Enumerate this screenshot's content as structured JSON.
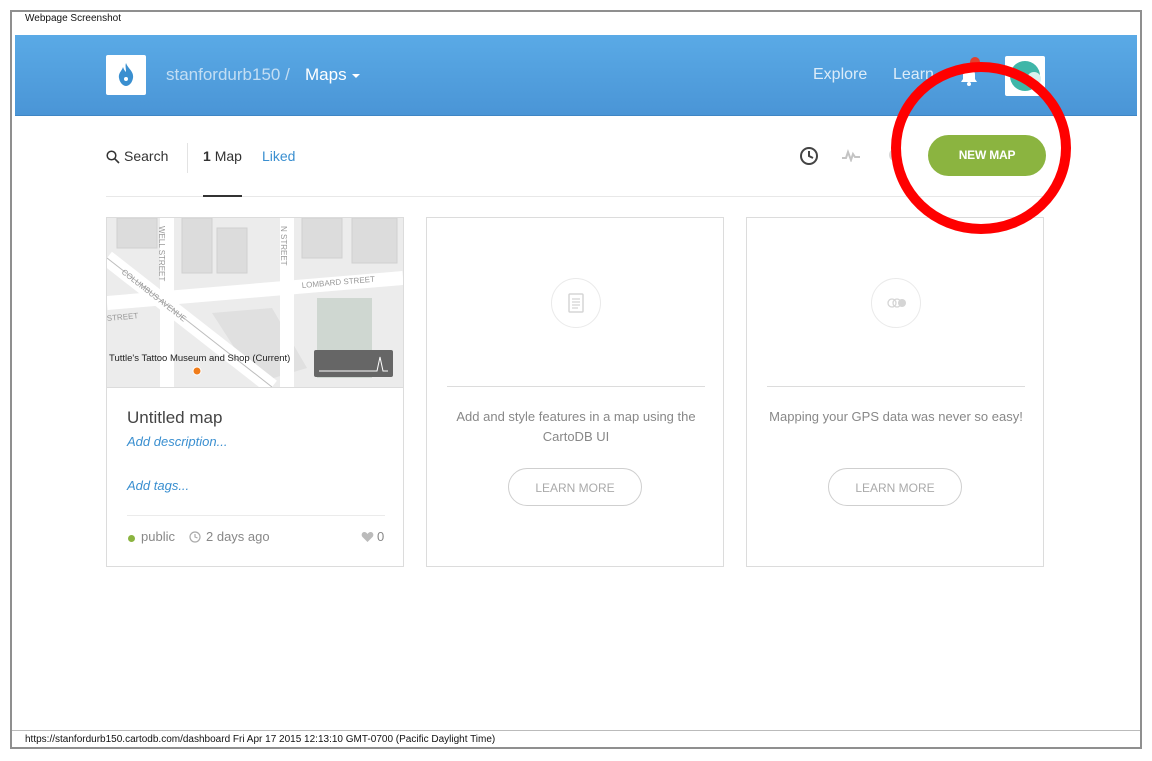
{
  "screenshot_label": "Webpage Screenshot",
  "footer_url": "https://stanfordurb150.cartodb.com/dashboard Fri Apr 17 2015 12:13:10 GMT-0700 (Pacific Daylight Time)",
  "header": {
    "username": "stanfordurb150 /",
    "section": "Maps",
    "nav": {
      "explore": "Explore",
      "learn": "Learn"
    },
    "logo_icon": "flame-icon",
    "notification_icon": "bell-icon"
  },
  "subnav": {
    "search_label": "Search",
    "map_count": "1",
    "map_label": "Map",
    "liked_label": "Liked",
    "new_map_label": "NEW MAP"
  },
  "cards": {
    "map": {
      "title": "Untitled map",
      "description": "Add description...",
      "tags": "Add tags...",
      "privacy": "public",
      "updated": "2 days ago",
      "likes": "0",
      "thumbnail_labels": {
        "street1": "WELL STREET",
        "street2": "N STREET",
        "street3": "LOMBARD STREET",
        "street4": "COLUMBUS AVENUE",
        "street5": "STREET",
        "place": "Tuttle's Tattoo Museum and Shop (Current)"
      }
    },
    "promo1": {
      "text": "Add and style features in a map using the CartoDB UI",
      "button": "LEARN MORE",
      "icon": "document-icon"
    },
    "promo2": {
      "text": "Mapping your GPS data was never so easy!",
      "button": "LEARN MORE",
      "icon": "gps-track-icon"
    }
  },
  "colors": {
    "header_blue": "#4a9ee0",
    "primary_green": "#8bb440",
    "link_blue": "#3a8fd0",
    "annotation_red": "#ff0000"
  }
}
